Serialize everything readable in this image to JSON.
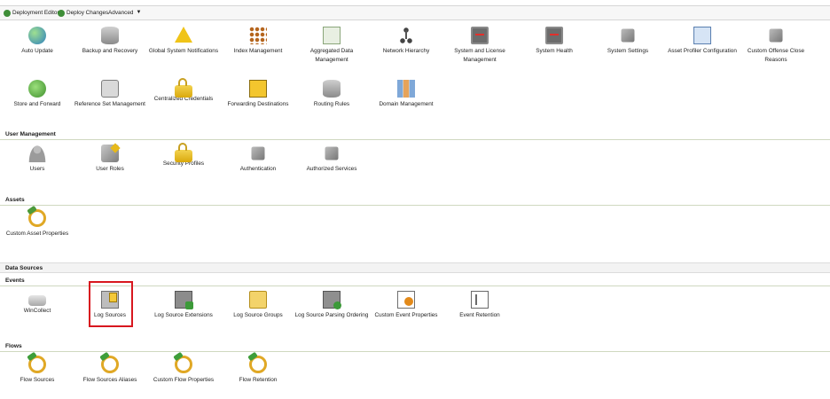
{
  "toolbar": {
    "deployment_editor": "Deployment Editor",
    "deploy_changes": "Deploy Changes",
    "advanced": "Advanced"
  },
  "system": [
    {
      "label": "Auto Update",
      "icon": "globe-update-icon"
    },
    {
      "label": "Backup and Recovery",
      "icon": "database-icon"
    },
    {
      "label": "Global System Notifications",
      "icon": "warning-icon"
    },
    {
      "label": "Index Management",
      "icon": "index-icon"
    },
    {
      "label": "Aggregated Data Management",
      "icon": "aggregated-data-icon"
    },
    {
      "label": "Network Hierarchy",
      "icon": "network-hierarchy-icon"
    },
    {
      "label": "System and License Management",
      "icon": "license-monitor-icon"
    },
    {
      "label": "System Health",
      "icon": "health-monitor-icon"
    },
    {
      "label": "System Settings",
      "icon": "settings-icon"
    },
    {
      "label": "Asset Profiler Configuration",
      "icon": "asset-profiler-icon"
    },
    {
      "label": "Custom Offense Close Reasons",
      "icon": "offense-close-icon"
    },
    {
      "label": "Store and Forward",
      "icon": "store-forward-icon"
    },
    {
      "label": "Reference Set Management",
      "icon": "reference-set-icon"
    },
    {
      "label": "Centralized Credentials",
      "icon": "lock-icon"
    },
    {
      "label": "Forwarding Destinations",
      "icon": "forwarding-icon"
    },
    {
      "label": "Routing Rules",
      "icon": "routing-icon"
    },
    {
      "label": "Domain Management",
      "icon": "domain-icon"
    }
  ],
  "sections": {
    "user_management": "User Management",
    "assets": "Assets",
    "data_sources": "Data Sources",
    "events": "Events",
    "flows": "Flows"
  },
  "user_management": [
    {
      "label": "Users",
      "icon": "users-icon"
    },
    {
      "label": "User Roles",
      "icon": "user-roles-icon"
    },
    {
      "label": "Security Profiles",
      "icon": "security-lock-icon"
    },
    {
      "label": "Authentication",
      "icon": "authentication-icon"
    },
    {
      "label": "Authorized Services",
      "icon": "authorized-services-icon"
    }
  ],
  "assets": [
    {
      "label": "Custom Asset Properties",
      "icon": "custom-asset-icon"
    }
  ],
  "events": [
    {
      "label": "WinCollect",
      "icon": "wincollect-icon"
    },
    {
      "label": "Log Sources",
      "icon": "log-sources-icon"
    },
    {
      "label": "Log Source Extensions",
      "icon": "log-extensions-icon"
    },
    {
      "label": "Log Source Groups",
      "icon": "folder-icon"
    },
    {
      "label": "Log Source Parsing Ordering",
      "icon": "parsing-order-icon"
    },
    {
      "label": "Custom Event Properties",
      "icon": "custom-event-icon"
    },
    {
      "label": "Event Retention",
      "icon": "retention-icon"
    }
  ],
  "flows": [
    {
      "label": "Flow Sources",
      "icon": "flow-sources-icon"
    },
    {
      "label": "Flow Sources Aliases",
      "icon": "flow-aliases-icon"
    },
    {
      "label": "Custom Flow Properties",
      "icon": "custom-flow-icon"
    },
    {
      "label": "Flow Retention",
      "icon": "flow-retention-icon"
    }
  ],
  "colors": {
    "highlight": "#d8171f",
    "section_rule": "#cfd8c0"
  }
}
